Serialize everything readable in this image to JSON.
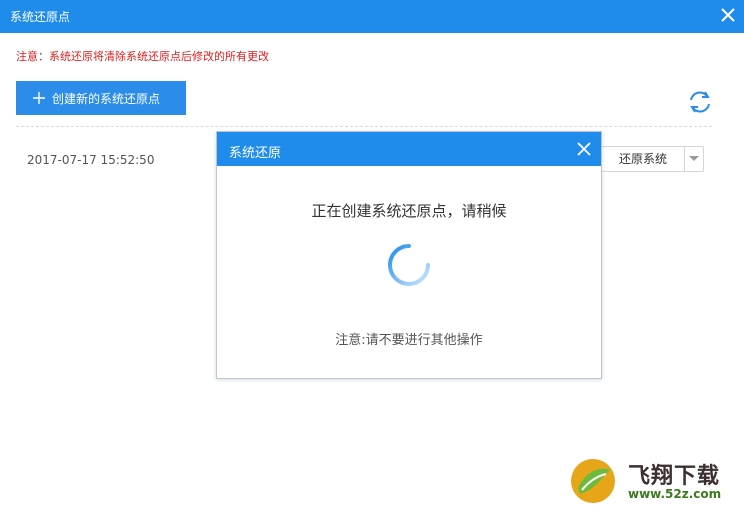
{
  "window": {
    "title": "系统还原点",
    "close_icon": "close-icon"
  },
  "notice": "注意：系统还原将清除系统还原点后修改的所有更改",
  "toolbar": {
    "create_label": "创建新的系统还原点",
    "refresh_icon": "refresh-icon"
  },
  "restore_points": [
    {
      "date": "2017-07-17 15:52:50",
      "action_label": "还原系统"
    }
  ],
  "modal": {
    "title": "系统还原",
    "message": "正在创建系统还原点，请稍候",
    "warning": "注意:请不要进行其他操作"
  },
  "watermark": {
    "name": "飞翔下载",
    "url": "www.52z.com"
  },
  "colors": {
    "accent": "#1f8ceb",
    "button": "#2b8de9",
    "notice": "#d92020"
  }
}
